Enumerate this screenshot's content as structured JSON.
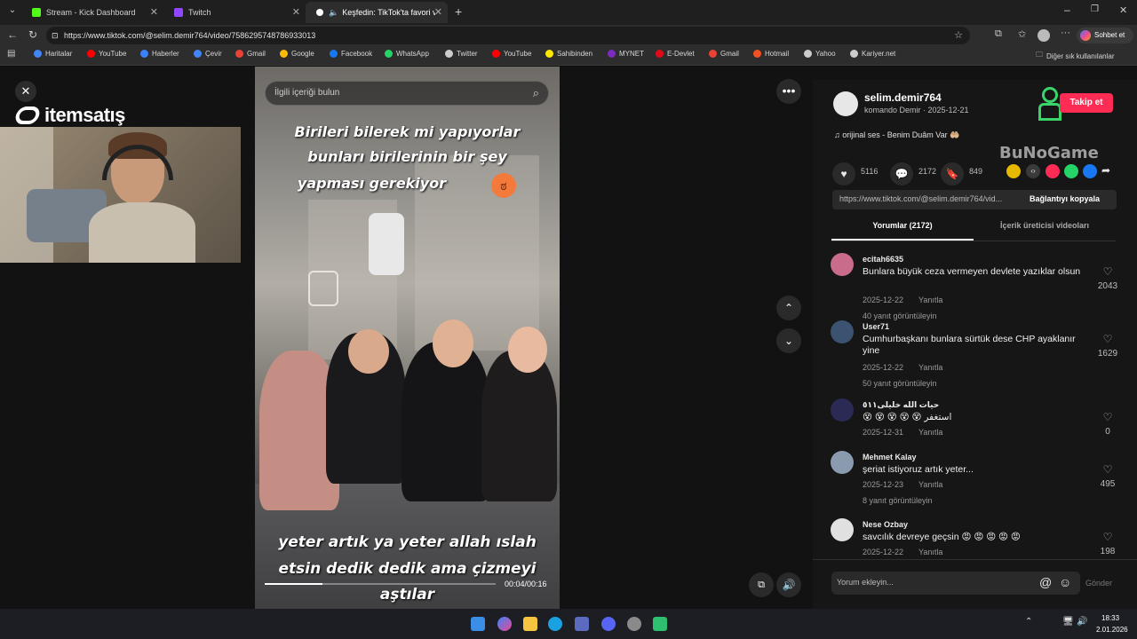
{
  "tabs": [
    {
      "label": "Stream - Kick Dashboard",
      "color": "#53fc18"
    },
    {
      "label": "Twitch",
      "color": "#9146ff"
    },
    {
      "label": "Keşfedin: TikTok'ta favori vide",
      "color": "#ffffff"
    }
  ],
  "address": {
    "url": "https://www.tiktok.com/@selim.demir764/video/7586295748786933013"
  },
  "bookmarks": [
    {
      "label": "Haritalar",
      "color": "#4285f4"
    },
    {
      "label": "YouTube",
      "color": "#ff0000"
    },
    {
      "label": "Haberler",
      "color": "#3b82f6"
    },
    {
      "label": "Çevir",
      "color": "#4285f4"
    },
    {
      "label": "Gmail",
      "color": "#ea4335"
    },
    {
      "label": "Google",
      "color": "#fbbc05"
    },
    {
      "label": "Facebook",
      "color": "#1877f2"
    },
    {
      "label": "WhatsApp",
      "color": "#25d366"
    },
    {
      "label": "Twitter",
      "color": "#cccccc"
    },
    {
      "label": "YouTube",
      "color": "#ff0000"
    },
    {
      "label": "Sahibinden",
      "color": "#ffe800"
    },
    {
      "label": "MYNET",
      "color": "#7b2cbf"
    },
    {
      "label": "E-Devlet",
      "color": "#e30a17"
    },
    {
      "label": "Gmail",
      "color": "#ea4335"
    },
    {
      "label": "Hotmail",
      "color": "#f25022"
    },
    {
      "label": "Yahoo",
      "color": "#cccccc"
    },
    {
      "label": "Kariyer.net",
      "color": "#cccccc"
    }
  ],
  "bookmarks_other": "Diğer sık kullanılanlar",
  "chat_button": "Sohbet et",
  "overlay_brand": "itemsatış",
  "search": {
    "placeholder": "İlgili içeriği bulun"
  },
  "video": {
    "caption_top": [
      "Birileri bilerek mi yapıyorlar",
      "bunları birilerinin bir şey",
      "yapması gerekiyor"
    ],
    "caption_bottom": [
      "yeter artık ya yeter allah ıslah",
      "etsin dedik dedik ama çizmeyi",
      "aştılar"
    ],
    "time": "00:04/00:16",
    "progress": 0.25
  },
  "author": {
    "handle": "selim.demir764",
    "name_date": "komando Demir · 2025-12-21",
    "sound": "orijinal ses - Benim Duâm Var 🤲🏼",
    "follow": "Takip et"
  },
  "stats": {
    "likes": "5116",
    "comments": "2172",
    "saves": "849"
  },
  "watermark": "BuNoGame",
  "copy": {
    "url": "https://www.tiktok.com/@selim.demir764/vid...",
    "button": "Bağlantıyı kopyala"
  },
  "panel_tabs": {
    "comments": "Yorumlar (2172)",
    "creator": "İçerik üreticisi videoları"
  },
  "comments": [
    {
      "user": "ecitah6635",
      "text": "Bunlara büyük ceza vermeyen devlete yazıklar olsun",
      "date": "2025-12-22",
      "reply": "Yanıtla",
      "likes": "2043",
      "more": "40 yanıt görüntüleyin",
      "avatar": "#c96b8a"
    },
    {
      "user": "User71",
      "text": "Cumhurbaşkanı bunlara sürtük dese CHP ayaklanır yine",
      "date": "2025-12-22",
      "reply": "Yanıtla",
      "likes": "1629",
      "more": "50 yanıt görüntüleyin",
      "avatar": "#3b5370"
    },
    {
      "user": "حيات الله خليلى٥١١",
      "text": "😵 😵 😵 😵 😵 استغفر",
      "date": "2025-12-31",
      "reply": "Yanıtla",
      "likes": "0",
      "more": "",
      "avatar": "#2a2a55"
    },
    {
      "user": "Mehmet Kalay",
      "text": "şeriat istiyoruz artık yeter...",
      "date": "2025-12-23",
      "reply": "Yanıtla",
      "likes": "495",
      "more": "8 yanıt görüntüleyin",
      "avatar": "#8a9bb0"
    },
    {
      "user": "Nese Ozbay",
      "text": "savcılık devreye geçsin 😡 😡 😡 😡 😡",
      "date": "2025-12-22",
      "reply": "Yanıtla",
      "likes": "198",
      "more": "",
      "avatar": "#e0e0e0"
    }
  ],
  "input": {
    "placeholder": "Yorum ekleyin...",
    "send": "Gönder"
  },
  "clock": {
    "time": "18:33",
    "date": "2.01.2026"
  }
}
